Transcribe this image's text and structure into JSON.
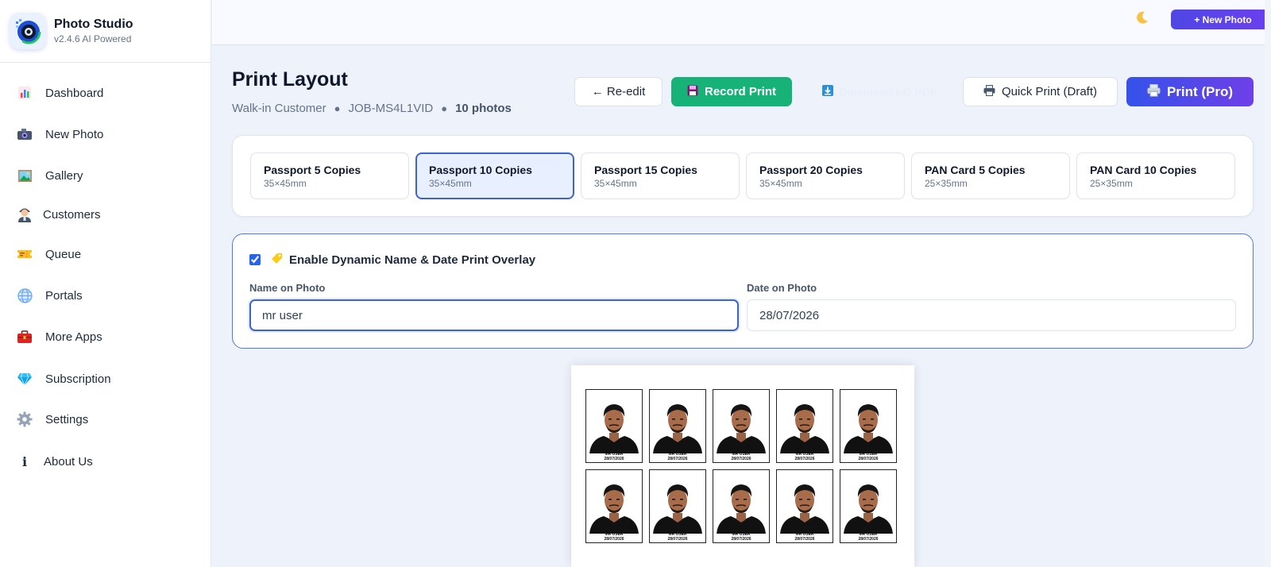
{
  "sidebar": {
    "brand_name": "Photo Studio",
    "version": "v2.4.6 AI Powered",
    "items": [
      {
        "label": "Dashboard",
        "icon": "chart-icon"
      },
      {
        "label": "New Photo",
        "icon": "camera-icon"
      },
      {
        "label": "Gallery",
        "icon": "image-icon"
      },
      {
        "label": "Customers",
        "icon": "person-icon"
      },
      {
        "label": "Queue",
        "icon": "ticket-icon"
      },
      {
        "label": "Portals",
        "icon": "globe-icon"
      },
      {
        "label": "More Apps",
        "icon": "toolbox-icon"
      },
      {
        "label": "Subscription",
        "icon": "diamond-icon"
      },
      {
        "label": "Settings",
        "icon": "gear-icon"
      },
      {
        "label": "About Us",
        "icon": "info-icon"
      }
    ]
  },
  "topbar": {
    "new_photo_label": "+ New Photo",
    "theme_icon": "moon-icon"
  },
  "header": {
    "title": "Print Layout",
    "customer": "Walk-in Customer",
    "job_id": "JOB-MS4L1VID",
    "photo_count": "10 photos"
  },
  "actions": {
    "reedit_label": "← Re-edit",
    "record_label": "Record Print",
    "download_label": "Download HD PDF",
    "quick_print_label": "Quick Print (Draft)",
    "pro_print_label": "Print (Pro)"
  },
  "presets": [
    {
      "name": "Passport 5 Copies",
      "size": "35×45mm",
      "active": false
    },
    {
      "name": "Passport 10 Copies",
      "size": "35×45mm",
      "active": true
    },
    {
      "name": "Passport 15 Copies",
      "size": "35×45mm",
      "active": false
    },
    {
      "name": "Passport 20 Copies",
      "size": "35×45mm",
      "active": false
    },
    {
      "name": "PAN Card 5 Copies",
      "size": "25×35mm",
      "active": false
    },
    {
      "name": "PAN Card 10 Copies",
      "size": "25×35mm",
      "active": false
    }
  ],
  "overlay": {
    "enabled": true,
    "title": "Enable Dynamic Name & Date Print Overlay",
    "name_label": "Name on Photo",
    "name_value": "mr user",
    "date_label": "Date on Photo",
    "date_value": "28/07/2026"
  },
  "sheet": {
    "caption_name": "MR USER",
    "caption_date": "28/07/2026",
    "photo_count": 10
  },
  "colors": {
    "accent": "#3b63d6",
    "record_green": "#16b278",
    "pro_gradient_start": "#3552ea",
    "pro_gradient_end": "#6f3fe8"
  }
}
